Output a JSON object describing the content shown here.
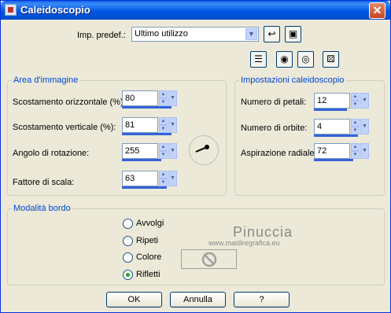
{
  "window": {
    "title": "Caleidoscopio",
    "close_label": "✕"
  },
  "preset": {
    "label": "Imp. predef.:",
    "value": "Ultimo utilizzo"
  },
  "image_area": {
    "legend": "Area d'immagine",
    "fields": [
      {
        "label": "Scostamento orizzontale (%):",
        "value": "80",
        "fill": 0.9
      },
      {
        "label": "Scostamento verticale (%):",
        "value": "81",
        "fill": 0.9
      },
      {
        "label": "Angolo di rotazione:",
        "value": "255",
        "fill": 0.71
      },
      {
        "label": "Fattore di scala:",
        "value": "63",
        "fill": 0.82
      }
    ]
  },
  "kaleido_settings": {
    "legend": "Impostazioni caleidoscopio",
    "fields": [
      {
        "label": "Numero di petali:",
        "value": "12",
        "fill": 0.6
      },
      {
        "label": "Numero di orbite:",
        "value": "4",
        "fill": 0.8
      },
      {
        "label": "Aspirazione radiale:",
        "value": "72",
        "fill": 0.72
      }
    ]
  },
  "border_mode": {
    "legend": "Modalità bordo",
    "options": [
      {
        "label": "Avvolgi",
        "checked": false
      },
      {
        "label": "Ripeti",
        "checked": false
      },
      {
        "label": "Colore",
        "checked": false
      },
      {
        "label": "Rifletti",
        "checked": true
      }
    ]
  },
  "watermark": {
    "name": "Pinuccia",
    "url": "www.maidiregrafica.eu"
  },
  "buttons": {
    "ok": "OK",
    "cancel": "Annulla",
    "help": "?"
  },
  "colors": {
    "accent": "#0046d5",
    "bar": "#3462d8",
    "title": "#0058e2"
  }
}
